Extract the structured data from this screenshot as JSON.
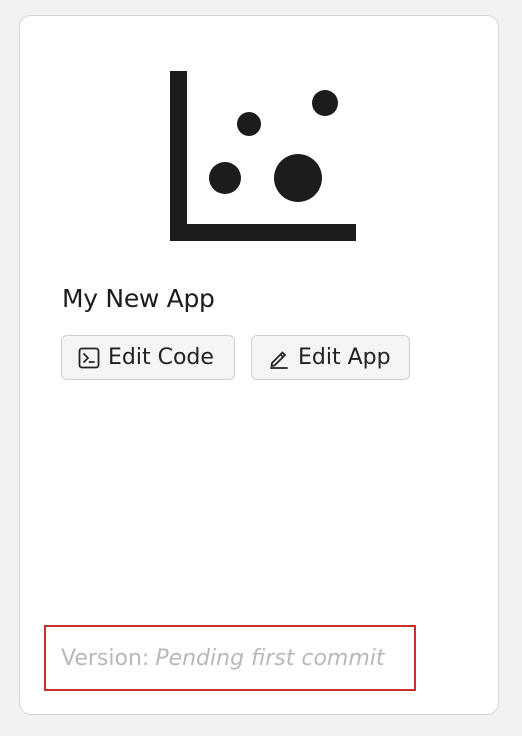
{
  "app": {
    "icon": "scatter-chart-icon",
    "title": "My New App"
  },
  "actions": {
    "edit_code_label": "Edit Code",
    "edit_code_icon": "terminal-icon",
    "edit_app_label": "Edit App",
    "edit_app_icon": "pencil-icon"
  },
  "version": {
    "label": "Version:",
    "value": "Pending first commit"
  },
  "colors": {
    "highlight_border": "#c8312a",
    "icon_fill": "#1c1c1c",
    "muted_text": "#b8b8b8"
  }
}
